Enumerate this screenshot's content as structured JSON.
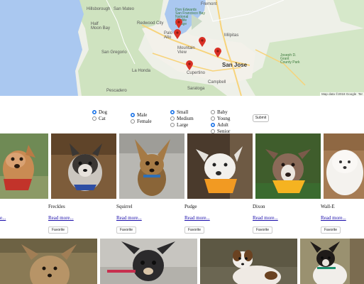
{
  "map": {
    "labels": {
      "fremont": "Fremont",
      "don_edwards": "Don Edwards\nSan Francisco Bay\nNational\nWildlife\nRefuge",
      "hillsborough": "Hillsborough",
      "san_mateo": "San Mateo",
      "redwood_city": "Redwood City",
      "half_moon_bay": "Half\nMoon Bay",
      "palo_alto": "Palo\nAlto",
      "milpitas": "Milpitas",
      "mountain_view": "Mountain\nView",
      "san_gregorio": "San Gregorio",
      "la_honda": "La Honda",
      "cupertino": "Cupertino",
      "san_jose": "San Jose",
      "campbell": "Campbell",
      "saratoga": "Saratoga",
      "pescadero": "Pescadero",
      "joseph_grant": "Joseph D.\nGrant\nCounty Park"
    },
    "attribution": "Map data ©2018 Google",
    "terms": "Ter",
    "marker_color": "#d93025"
  },
  "filters": {
    "species": [
      {
        "label": "Dog",
        "checked": true
      },
      {
        "label": "Cat",
        "checked": false
      }
    ],
    "gender": [
      {
        "label": "Male",
        "checked": true
      },
      {
        "label": "Female",
        "checked": false
      }
    ],
    "size": [
      {
        "label": "Small",
        "checked": true
      },
      {
        "label": "Medium",
        "checked": false
      },
      {
        "label": "Large",
        "checked": false
      }
    ],
    "age": [
      {
        "label": "Baby",
        "checked": false
      },
      {
        "label": "Young",
        "checked": false
      },
      {
        "label": "Adult",
        "checked": true
      },
      {
        "label": "Senior",
        "checked": false
      }
    ],
    "submit_label": "Submit"
  },
  "pets_row1": [
    {
      "name": "",
      "read_more": "e..."
    },
    {
      "name": "Freckles",
      "read_more": "Read more...",
      "favorite": "Favorite"
    },
    {
      "name": "Squirrel",
      "read_more": "Read more...",
      "favorite": "Favorite"
    },
    {
      "name": "Pudge",
      "read_more": "Read more...",
      "favorite": "Favorite"
    },
    {
      "name": "Dixon",
      "read_more": "Read more...",
      "favorite": "Favorite"
    },
    {
      "name": "Wall-E",
      "read_more": "Read more...",
      "favorite": "Favorite"
    }
  ]
}
